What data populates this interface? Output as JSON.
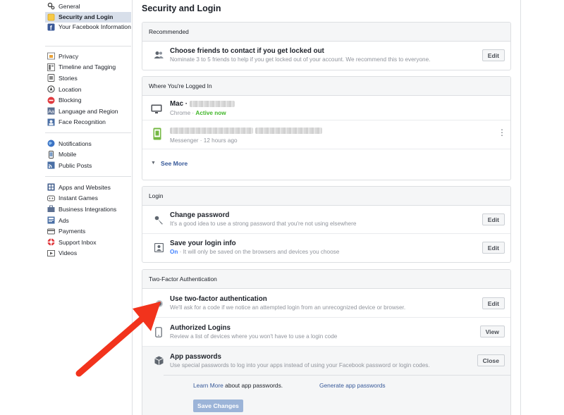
{
  "sidebar": {
    "group1": [
      {
        "label": "General",
        "icon": "gear-icon"
      },
      {
        "label": "Security and Login",
        "icon": "shield-icon",
        "active": true
      },
      {
        "label": "Your Facebook Information",
        "icon": "facebook-icon"
      }
    ],
    "group2": [
      {
        "label": "Privacy",
        "icon": "privacy-lock-icon"
      },
      {
        "label": "Timeline and Tagging",
        "icon": "timeline-icon"
      },
      {
        "label": "Stories",
        "icon": "stories-icon"
      },
      {
        "label": "Location",
        "icon": "location-icon"
      },
      {
        "label": "Blocking",
        "icon": "blocking-icon"
      },
      {
        "label": "Language and Region",
        "icon": "language-icon"
      },
      {
        "label": "Face Recognition",
        "icon": "face-recognition-icon"
      }
    ],
    "group3": [
      {
        "label": "Notifications",
        "icon": "globe-icon"
      },
      {
        "label": "Mobile",
        "icon": "mobile-icon"
      },
      {
        "label": "Public Posts",
        "icon": "rss-icon"
      }
    ],
    "group4": [
      {
        "label": "Apps and Websites",
        "icon": "apps-icon"
      },
      {
        "label": "Instant Games",
        "icon": "games-icon"
      },
      {
        "label": "Business Integrations",
        "icon": "business-icon"
      },
      {
        "label": "Ads",
        "icon": "ads-icon"
      },
      {
        "label": "Payments",
        "icon": "payments-icon"
      },
      {
        "label": "Support Inbox",
        "icon": "support-icon"
      },
      {
        "label": "Videos",
        "icon": "videos-icon"
      }
    ]
  },
  "page": {
    "title": "Security and Login"
  },
  "recommended": {
    "header": "Recommended",
    "title": "Choose friends to contact if you get locked out",
    "subtitle": "Nominate 3 to 5 friends to help if you get locked out of your account. We recommend this to everyone.",
    "button": "Edit"
  },
  "logged_in": {
    "header": "Where You're Logged In",
    "device1": {
      "name": "Mac ·",
      "app": "Chrome ·",
      "status": "Active now"
    },
    "device2": {
      "app": "Messenger · 12 hours ago"
    },
    "see_more": "See More"
  },
  "login": {
    "header": "Login",
    "change_password": {
      "title": "Change password",
      "subtitle": "It's a good idea to use a strong password that you're not using elsewhere",
      "button": "Edit"
    },
    "save_login": {
      "title": "Save your login info",
      "status": "On",
      "subtitle": "· It will only be saved on the browsers and devices you choose",
      "button": "Edit"
    }
  },
  "two_factor": {
    "header": "Two-Factor Authentication",
    "use_2fa": {
      "title": "Use two-factor authentication",
      "subtitle": "We'll ask for a code if we notice an attempted login from an unrecognized device or browser.",
      "button": "Edit"
    },
    "authorized": {
      "title": "Authorized Logins",
      "subtitle": "Review a list of devices where you won't have to use a login code",
      "button": "View"
    },
    "app_passwords": {
      "title": "App passwords",
      "subtitle": "Use special passwords to log into your apps instead of using your Facebook password or login codes.",
      "button": "Close"
    },
    "learn_more": "Learn More",
    "about_text": "about app passwords.",
    "generate": "Generate app passwords",
    "save_changes": "Save Changes"
  },
  "colors": {
    "accent": "#365899",
    "active_green": "#42b72a",
    "arrow_red": "#f2331c",
    "sidebar_active": "#d8dfea"
  }
}
